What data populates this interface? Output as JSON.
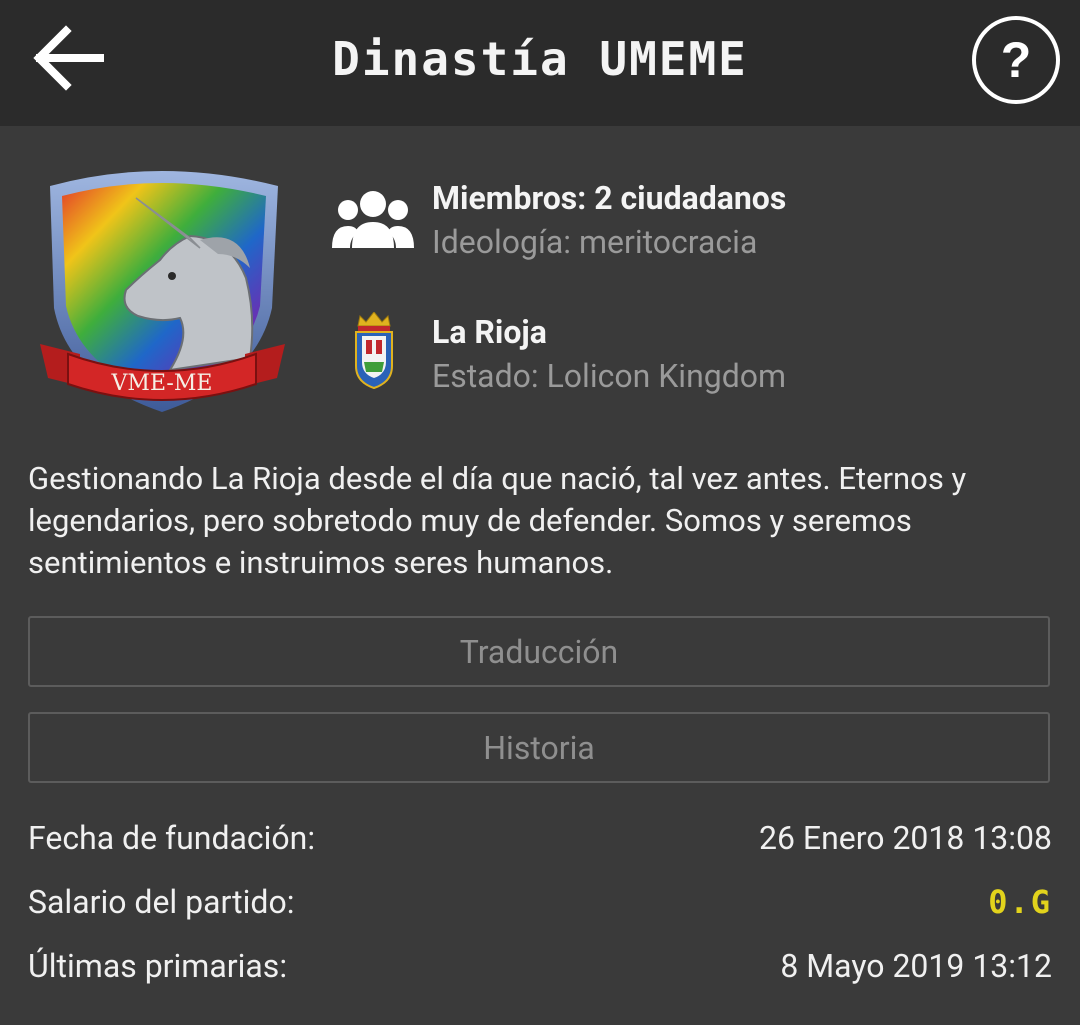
{
  "header": {
    "title": "Dinastía UMEME",
    "back_icon": "arrow-left-icon",
    "help_label": "?"
  },
  "emblem": {
    "banner_text": "VME-ME",
    "icon": "unicorn-shield-emblem"
  },
  "info": {
    "members_label": "Miembros: 2 ciudadanos",
    "ideology_label": "Ideología: meritocracia",
    "region_name": "La Rioja",
    "state_label": "Estado: Lolicon Kingdom",
    "members_icon": "group-icon",
    "region_icon": "coat-of-arms-icon"
  },
  "description": "Gestionando La Rioja desde el día que nació, tal vez antes. Eternos y legendarios, pero sobretodo muy de defender. Somos y seremos sentimientos e instruimos seres humanos.",
  "buttons": {
    "translation": "Traducción",
    "history": "Historia"
  },
  "stats": [
    {
      "label": "Fecha de fundación:",
      "value": "26 Enero 2018 13:08"
    },
    {
      "label": "Salario del partido:",
      "value": "0.G"
    },
    {
      "label": "Últimas primarias:",
      "value": "8 Mayo 2019 13:12"
    }
  ],
  "colors": {
    "background": "#3a3a3a",
    "topbar": "#2b2b2b",
    "gold": "#e2d31c"
  }
}
